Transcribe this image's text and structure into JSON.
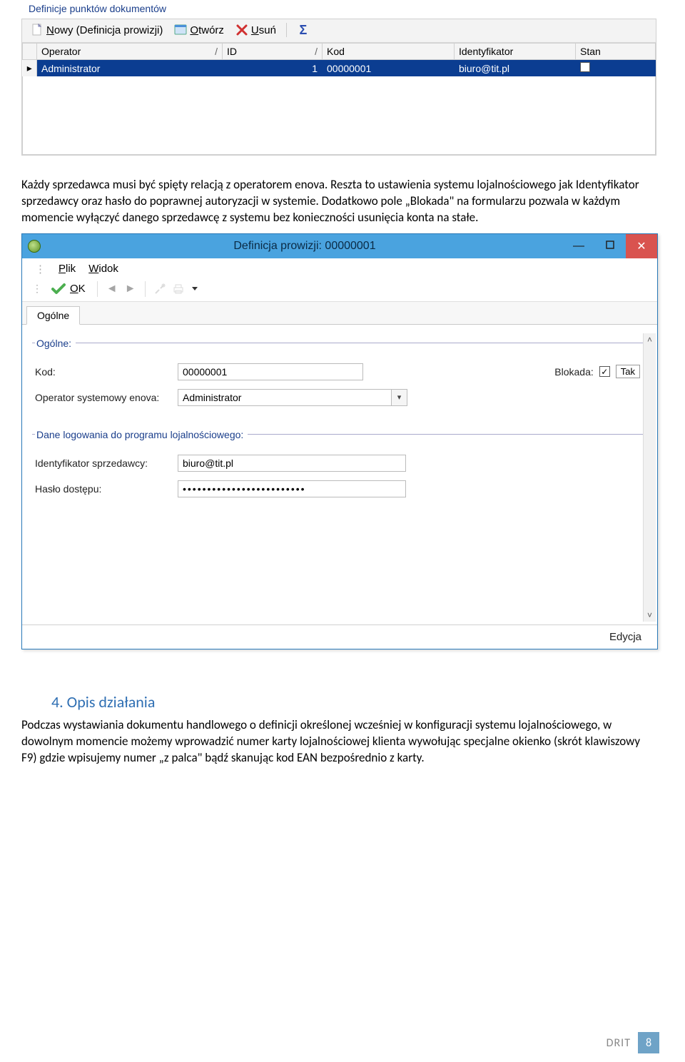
{
  "grid_panel": {
    "group_title": "Definicje punktów dokumentów",
    "toolbar": {
      "new_label": "Nowy (Definicja prowizji)",
      "open_label": "Otwórz",
      "delete_label": "Usuń"
    },
    "columns": [
      {
        "label": "Operator",
        "sortable": true
      },
      {
        "label": "ID",
        "sortable": true
      },
      {
        "label": "Kod",
        "sortable": false
      },
      {
        "label": "Identyfikator",
        "sortable": false
      },
      {
        "label": "Stan",
        "sortable": false
      }
    ],
    "row": {
      "operator": "Administrator",
      "id": "1",
      "kod": "00000001",
      "ident": "biuro@tit.pl"
    }
  },
  "paragraph1": "Każdy sprzedawca musi być spięty relacją z operatorem enova. Reszta to ustawienia systemu lojalnościowego jak Identyfikator sprzedawcy oraz hasło do poprawnej autoryzacji w systemie. Dodatkowo pole „Blokada\" na formularzu pozwala w każdym momencie wyłączyć danego sprzedawcę z systemu bez konieczności usunięcia konta na stałe.",
  "window": {
    "title": "Definicja prowizji: 00000001",
    "menus": {
      "file": "Plik",
      "view": "Widok"
    },
    "ok_label": "OK",
    "tab_label": "Ogólne",
    "group1": "Ogólne:",
    "group2": "Dane logowania do programu lojalnościowego:",
    "labels": {
      "kod": "Kod:",
      "blokada": "Blokada:",
      "operator": "Operator systemowy enova:",
      "ident": "Identyfikator sprzedawcy:",
      "haslo": "Hasło dostępu:"
    },
    "values": {
      "kod": "00000001",
      "operator": "Administrator",
      "blokada_checked": true,
      "blokada_text": "Tak",
      "ident": "biuro@tit.pl",
      "haslo_masked": "•••••••••••••••••••••••••"
    },
    "status": "Edycja"
  },
  "section4": {
    "heading": "4. Opis działania",
    "body": "Podczas wystawiania dokumentu handlowego o definicji określonej wcześniej w konfiguracji systemu lojalnościowego, w dowolnym momencie możemy wprowadzić numer karty lojalnościowej klienta wywołując specjalne okienko (skrót klawiszowy F9) gdzie wpisujemy numer „z palca\" bądź skanując kod EAN bezpośrednio z karty."
  },
  "footer": {
    "brand": "DRIT",
    "page": "8"
  }
}
